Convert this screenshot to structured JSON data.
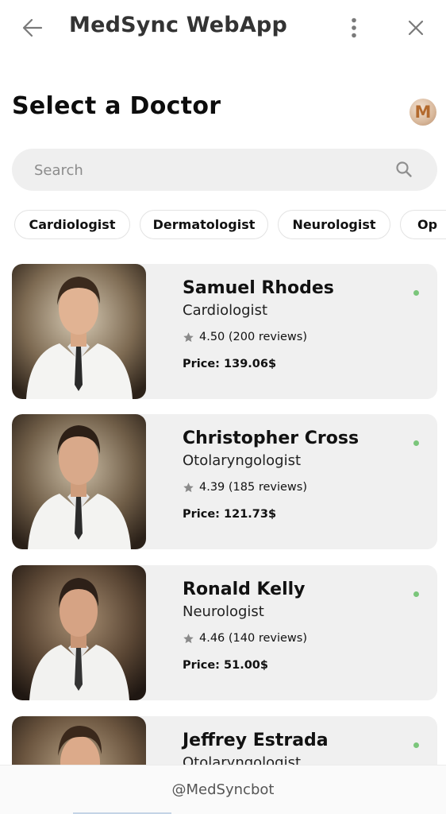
{
  "header": {
    "title": "MedSync WebApp",
    "back_icon": "arrow-left-icon",
    "more_icon": "vertical-dots-icon",
    "close_icon": "close-x-icon"
  },
  "page": {
    "title": "Select a Doctor",
    "avatar_letter": "M"
  },
  "search": {
    "placeholder": "Search",
    "value": "",
    "icon": "search-icon"
  },
  "filters": [
    "Cardiologist",
    "Dermatologist",
    "Neurologist",
    "Op"
  ],
  "doctors": [
    {
      "name": "Samuel Rhodes",
      "specialty": "Cardiologist",
      "rating": "4.50 (200 reviews)",
      "price": "Price: 139.06$"
    },
    {
      "name": "Christopher Cross",
      "specialty": "Otolaryngologist",
      "rating": "4.39 (185 reviews)",
      "price": "Price: 121.73$"
    },
    {
      "name": "Ronald Kelly",
      "specialty": "Neurologist",
      "rating": "4.46 (140 reviews)",
      "price": "Price: 51.00$"
    },
    {
      "name": "Jeffrey Estrada",
      "specialty": "Otolaryngologist",
      "rating": "",
      "price": ""
    }
  ],
  "footer": {
    "handle": "@MedSyncbot"
  },
  "colors": {
    "status_online": "#7bc67b",
    "card_bg": "#f0f0f0",
    "search_bg": "#efefef",
    "star": "#8a8a8a"
  }
}
